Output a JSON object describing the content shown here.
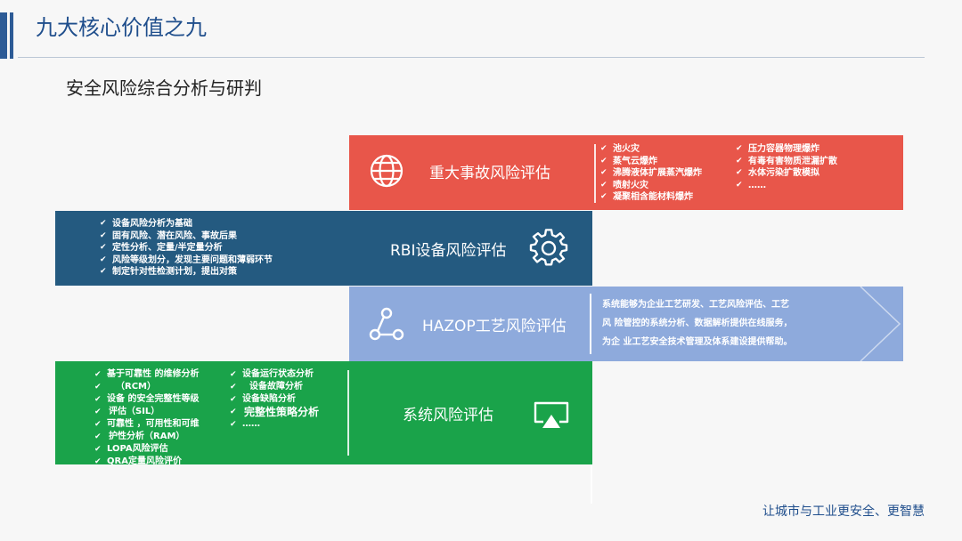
{
  "header": {
    "title": "九大核心价值之九",
    "subtitle": "安全风险综合分析与研判"
  },
  "bands": {
    "major": {
      "title": "重大事故风险评估",
      "icon": "globe-icon",
      "color": "#e8564a",
      "col1": [
        "池火灾",
        "蒸气云爆炸",
        "沸腾液体扩展蒸汽爆炸",
        "喷射火灾",
        "凝聚相含能材料爆炸"
      ],
      "col2": [
        "压力容器物理爆炸",
        "有毒有害物质泄漏扩散",
        "水体污染扩散模拟",
        "……"
      ]
    },
    "rbi": {
      "title": "RBI设备风险评估",
      "icon": "gear-icon",
      "color": "#245a80",
      "items": [
        "设备风险分析为基础",
        "固有风险、潜在风险、事故后果",
        "定性分析、定量/半定量分析",
        "风险等级划分，发现主要问题和薄弱环节",
        "制定针对性检测计划，提出对策"
      ]
    },
    "hazop": {
      "title": "HAZOP工艺风险评估",
      "icon": "share-nodes-icon",
      "color": "#8eaadc",
      "desc_lines": [
        "系统能够为企业工艺研发、工艺风险评估、工艺",
        "风 险管控的系统分析、数据解析提供在线服务，",
        "为企 业工艺安全技术管理及体系建设提供帮助。"
      ]
    },
    "system": {
      "title": "系统风险评估",
      "icon": "screen-cast-icon",
      "color": "#1aa34a",
      "col1": [
        "基于可靠性 的维修分析",
        "（RCM）",
        "设备 的安全完整性等级",
        "评估（SIL）",
        "可靠性 ，可用性和可维",
        "护性分析（RAM）",
        "LOPA风险评估",
        "QRA定量风险评价"
      ],
      "col2": [
        "设备运行状态分析",
        "设备故障分析",
        "设备缺陷分析",
        "完整性策略分析",
        "……"
      ]
    }
  },
  "footer": {
    "slogan": "让城市与工业更安全、更智慧"
  }
}
